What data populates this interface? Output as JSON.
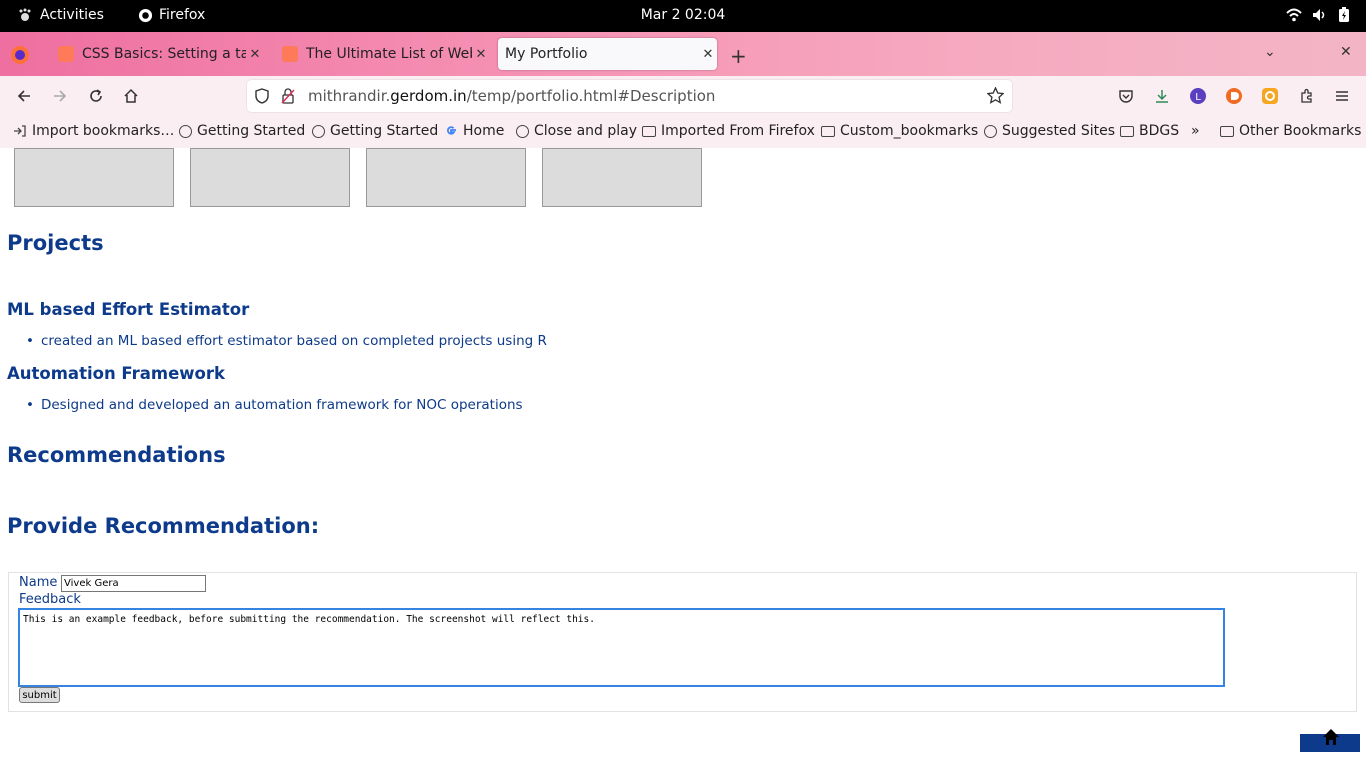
{
  "system": {
    "activities_label": "Activities",
    "app_label": "Firefox",
    "clock": "Mar 2  02:04",
    "tray_icons": [
      "wifi-icon",
      "volume-icon",
      "battery-icon"
    ]
  },
  "tabs": [
    {
      "title": "CSS Basics: Setting a table",
      "icon": "hubspot-icon",
      "active": false
    },
    {
      "title": "The Ultimate List of Web-",
      "icon": "hubspot-icon",
      "active": false
    },
    {
      "title": "My Portfolio",
      "icon": "",
      "active": true
    }
  ],
  "toolbar": {
    "url_prefix": "mithrandir.",
    "url_domain": "gerdom.in",
    "url_path": "/temp/portfolio.html#Description"
  },
  "bookmarks": {
    "items": [
      {
        "label": "Import bookmarks…",
        "icon": "import-icon"
      },
      {
        "label": "Getting Started",
        "icon": "globe-icon"
      },
      {
        "label": "Getting Started",
        "icon": "globe-icon"
      },
      {
        "label": "Home",
        "icon": "google-icon"
      },
      {
        "label": "Close and play",
        "icon": "globe-icon"
      },
      {
        "label": "Imported From Firefox",
        "icon": "folder-icon"
      },
      {
        "label": "Custom_bookmarks",
        "icon": "folder-icon"
      },
      {
        "label": "Suggested Sites",
        "icon": "globe-icon"
      },
      {
        "label": "BDGS",
        "icon": "folder-icon"
      }
    ],
    "other_label": "Other Bookmarks"
  },
  "page": {
    "projects_heading": "Projects",
    "projects": [
      {
        "title": "ML based Effort Estimator",
        "bullet": "created an ML based effort estimator based on completed projects using R"
      },
      {
        "title": "Automation Framework",
        "bullet": "Designed and developed an automation framework for NOC operations"
      }
    ],
    "recommendations_heading": "Recommendations",
    "provide_heading": "Provide Recommendation:",
    "form": {
      "name_label": "Name",
      "name_value": "Vivek Gera",
      "feedback_label": "Feedback",
      "feedback_value": "This is an example feedback, before submitting the recommendation. The screenshot will reflect this. ",
      "submit_label": "submit"
    }
  },
  "colors": {
    "heading": "#0d3a8a",
    "tabbar_start": "#ee6fa0",
    "tabbar_end": "#f3b5c6",
    "toolbar_bg": "#fbeef2"
  }
}
